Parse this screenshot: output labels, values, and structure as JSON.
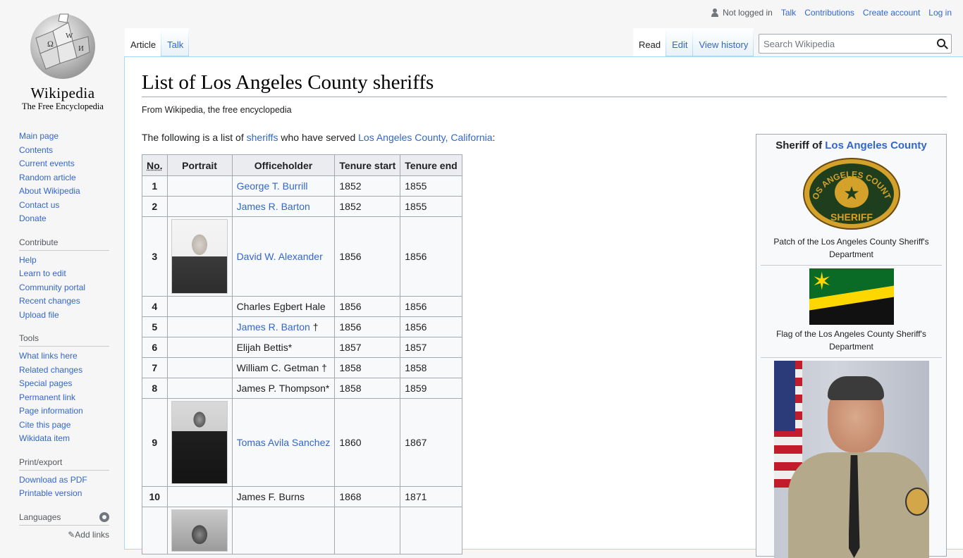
{
  "logo": {
    "wordmark": "Wikipedia",
    "tagline": "The Free Encyclopedia"
  },
  "personal": {
    "status": "Not logged in",
    "links": [
      "Talk",
      "Contributions",
      "Create account",
      "Log in"
    ]
  },
  "tabs": {
    "left": [
      {
        "label": "Article",
        "selected": true
      },
      {
        "label": "Talk",
        "selected": false
      }
    ],
    "right": [
      {
        "label": "Read",
        "selected": true
      },
      {
        "label": "Edit",
        "selected": false
      },
      {
        "label": "View history",
        "selected": false
      }
    ]
  },
  "search": {
    "placeholder": "Search Wikipedia"
  },
  "sidebar": {
    "navigation": [
      "Main page",
      "Contents",
      "Current events",
      "Random article",
      "About Wikipedia",
      "Contact us",
      "Donate"
    ],
    "contribute": {
      "heading": "Contribute",
      "items": [
        "Help",
        "Learn to edit",
        "Community portal",
        "Recent changes",
        "Upload file"
      ]
    },
    "tools": {
      "heading": "Tools",
      "items": [
        "What links here",
        "Related changes",
        "Special pages",
        "Permanent link",
        "Page information",
        "Cite this page",
        "Wikidata item"
      ]
    },
    "print": {
      "heading": "Print/export",
      "items": [
        "Download as PDF",
        "Printable version"
      ]
    },
    "languages": {
      "heading": "Languages",
      "add_links": "Add links"
    }
  },
  "article": {
    "title": "List of Los Angeles County sheriffs",
    "from": "From Wikipedia, the free encyclopedia",
    "intro": {
      "prefix": "The following is a list of ",
      "link1": "sheriffs",
      "middle": " who have served ",
      "link2": "Los Angeles County, California",
      "suffix": ":"
    }
  },
  "table": {
    "headers": [
      "No.",
      "Portrait",
      "Officeholder",
      "Tenure start",
      "Tenure end"
    ],
    "rows": [
      {
        "no": "1",
        "name": "George T. Burrill",
        "link": true,
        "mark": "",
        "start": "1852",
        "end": "1855",
        "portrait": ""
      },
      {
        "no": "2",
        "name": "James R. Barton",
        "link": true,
        "mark": "",
        "start": "1852",
        "end": "1855",
        "portrait": ""
      },
      {
        "no": "3",
        "name": "David W. Alexander",
        "link": true,
        "mark": "",
        "start": "1856",
        "end": "1856",
        "portrait": "alexander"
      },
      {
        "no": "4",
        "name": "Charles Egbert Hale",
        "link": false,
        "mark": "",
        "start": "1856",
        "end": "1856",
        "portrait": ""
      },
      {
        "no": "5",
        "name": "James R. Barton",
        "link": true,
        "mark": " †",
        "start": "1856",
        "end": "1856",
        "portrait": ""
      },
      {
        "no": "6",
        "name": "Elijah Bettis*",
        "link": false,
        "mark": "",
        "start": "1857",
        "end": "1857",
        "portrait": ""
      },
      {
        "no": "7",
        "name": "William C. Getman",
        "link": false,
        "mark": " †",
        "start": "1858",
        "end": "1858",
        "portrait": ""
      },
      {
        "no": "8",
        "name": "James P. Thompson*",
        "link": false,
        "mark": "",
        "start": "1858",
        "end": "1859",
        "portrait": ""
      },
      {
        "no": "9",
        "name": "Tomas Avila Sanchez",
        "link": true,
        "mark": "",
        "start": "1860",
        "end": "1867",
        "portrait": "sanchez"
      },
      {
        "no": "10",
        "name": "James F. Burns",
        "link": false,
        "mark": "",
        "start": "1868",
        "end": "1871",
        "portrait": ""
      },
      {
        "no": "",
        "name": "",
        "link": false,
        "mark": "",
        "start": "",
        "end": "",
        "portrait": "next"
      }
    ]
  },
  "infobox": {
    "title_prefix": "Sheriff of ",
    "title_link": "Los Angeles County",
    "patch_caption": "Patch of the Los Angeles County Sheriff's Department",
    "patch_text": {
      "top": "LOS ANGELES COUNTY",
      "bottom": "SHERIFF"
    },
    "flag_caption": "Flag of the Los Angeles County Sheriff's Department"
  }
}
